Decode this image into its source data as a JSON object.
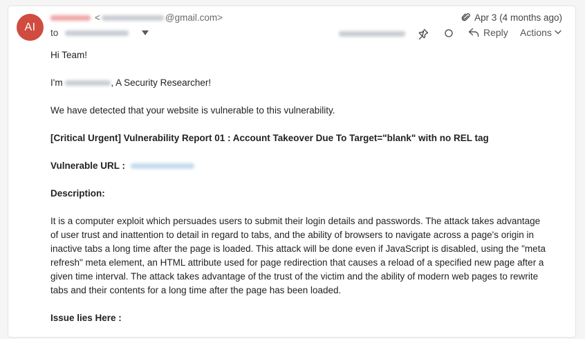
{
  "sender": {
    "avatar_initials": "AI",
    "avatar_color": "#d04b40",
    "email_open": "<",
    "email_domain": "@gmail.com>"
  },
  "recipient": {
    "to_label": "to"
  },
  "meta": {
    "date": "Apr 3 (4 months ago)"
  },
  "actions": {
    "reply_label": "Reply",
    "more_label": "Actions"
  },
  "body": {
    "greeting": "Hi Team!",
    "intro_prefix": "I'm",
    "intro_suffix": ", A Security Researcher!",
    "detected": "We have detected that your website is vulnerable to this vulnerability.",
    "report_title": "[Critical Urgent] Vulnerability Report 01 : Account Takeover Due To Target=\"blank\" with no REL tag",
    "vulnerable_url_label": "Vulnerable URL :",
    "description_label": "Description:",
    "description_text": "It is a computer exploit  which persuades users to submit their login details and passwords. The attack takes advantage of user trust and inattention to detail in regard to tabs, and the ability of browsers to navigate across a page's origin in inactive tabs a long time after the page is loaded. This attack will be done even if JavaScript is disabled, using the \"meta refresh\" meta element, an HTML attribute used for page redirection that causes a reload of a specified new page after a given time interval.  The attack takes advantage of the trust of the victim and the ability of modern web pages to rewrite tabs and their contents for a long time after the page has been loaded.",
    "issue_label": "Issue lies Here :"
  }
}
